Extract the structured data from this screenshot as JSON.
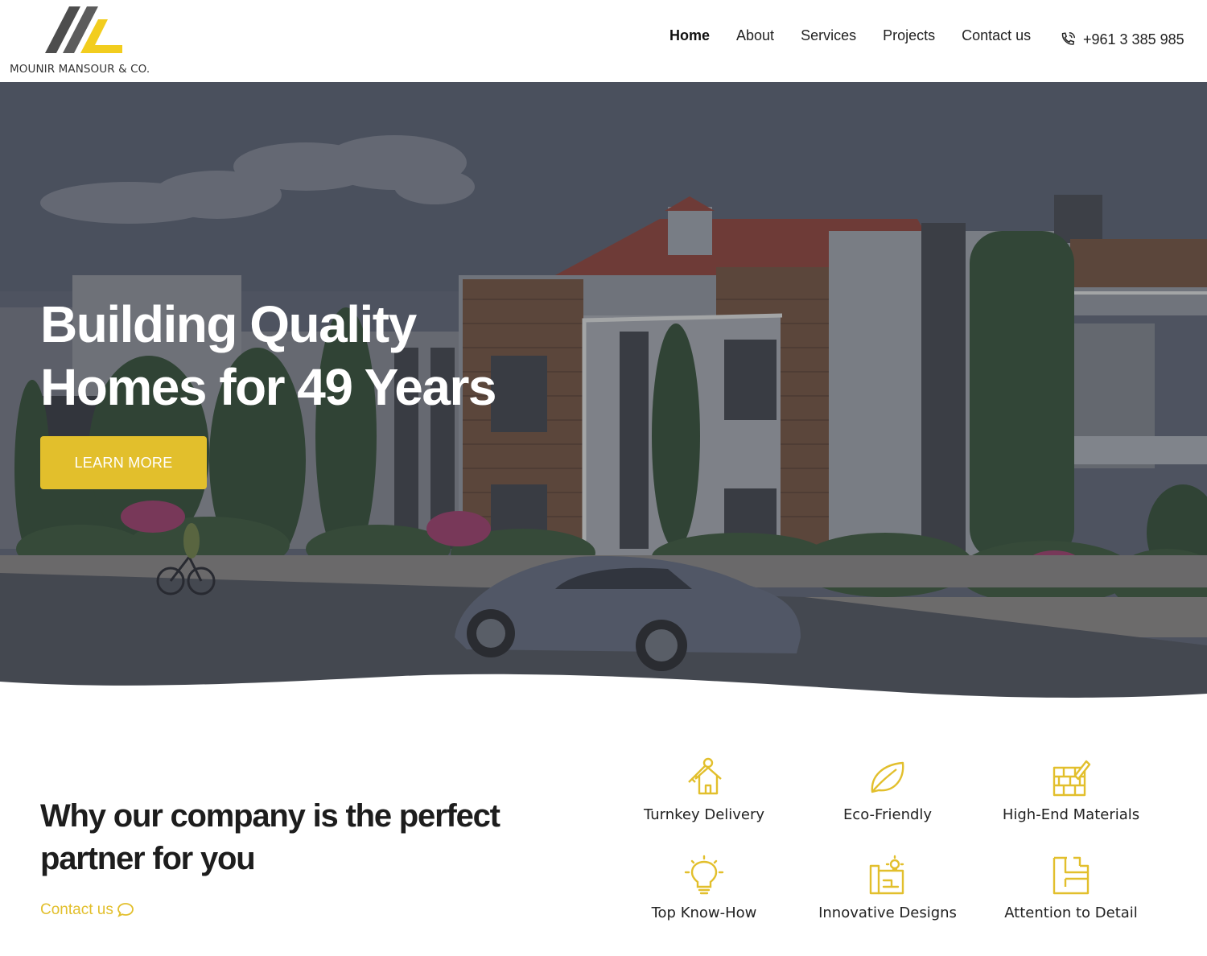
{
  "header": {
    "logo_text": "MOUNIR MANSOUR & CO.",
    "nav": [
      "Home",
      "About",
      "Services",
      "Projects",
      "Contact us"
    ],
    "active": "Home",
    "phone": "+961 3 385 985"
  },
  "hero": {
    "title_line1": "Building Quality",
    "title_line2": "Homes for 49 Years",
    "cta": "LEARN MORE"
  },
  "why": {
    "title_line1": "Why our company is the perfect",
    "title_line2": "partner for you",
    "link": "Contact us"
  },
  "features": [
    {
      "label": "Turnkey Delivery",
      "icon": "key-house-icon"
    },
    {
      "label": "Eco-Friendly",
      "icon": "leaf-icon"
    },
    {
      "label": "High-End Materials",
      "icon": "brick-trowel-icon"
    },
    {
      "label": "Top Know-How",
      "icon": "lightbulb-icon"
    },
    {
      "label": "Innovative Designs",
      "icon": "blueprint-idea-icon"
    },
    {
      "label": "Attention to Detail",
      "icon": "floorplan-icon"
    }
  ],
  "colors": {
    "accent": "#e2bf2c",
    "text": "#1d1d1d",
    "overlay": "#4a5060"
  }
}
